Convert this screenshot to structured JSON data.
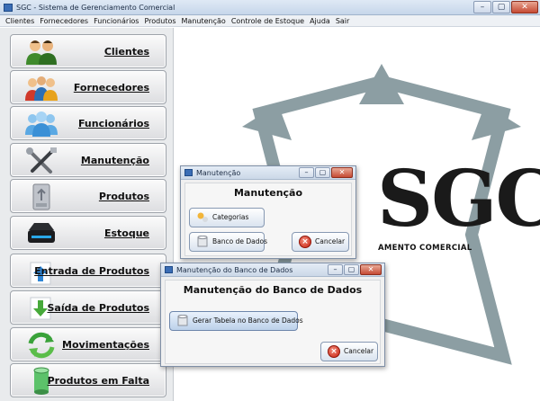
{
  "window": {
    "title": "SGC - Sistema de Gerenciamento Comercial",
    "controls": [
      "–",
      "▢",
      "✕"
    ]
  },
  "menu": [
    "Clientes",
    "Fornecedores",
    "Funcionários",
    "Produtos",
    "Manutenção",
    "Controle de Estoque",
    "Ajuda",
    "Sair"
  ],
  "sidebar": {
    "items": [
      {
        "label": "Clientes",
        "icon": "users-icon"
      },
      {
        "label": "Fornecedores",
        "icon": "suppliers-icon"
      },
      {
        "label": "Funcionários",
        "icon": "employees-icon"
      },
      {
        "label": "Manutenção",
        "icon": "tools-icon"
      },
      {
        "label": "Produtos",
        "icon": "product-box-icon"
      },
      {
        "label": "Estoque",
        "icon": "storage-drive-icon"
      },
      {
        "label": "Entrada de Produtos",
        "icon": "arrow-up-icon"
      },
      {
        "label": "Saída de Produtos",
        "icon": "arrow-down-icon"
      },
      {
        "label": "Movimentações",
        "icon": "refresh-icon"
      },
      {
        "label": "Produtos em Falta",
        "icon": "cylinder-icon"
      }
    ]
  },
  "logo": {
    "text": "SGC",
    "subtitle": "AMENTO COMERCIAL",
    "colors": {
      "shape": "#8c9ea3",
      "text": "#1a1a1a"
    }
  },
  "dialog_manutencao": {
    "title": "Manutenção",
    "heading": "Manutenção",
    "controls": [
      "–",
      "▢",
      "✕"
    ],
    "buttons": {
      "categorias": "Categorias",
      "banco": "Banco de Dados",
      "cancel": "Cancelar"
    }
  },
  "dialog_banco": {
    "title": "Manutenção do Banco de Dados",
    "heading": "Manutenção do Banco de Dados",
    "controls": [
      "–",
      "▢",
      "✕"
    ],
    "buttons": {
      "gerar": "Gerar Tabela no Banco de Dados",
      "cancel": "Cancelar"
    }
  }
}
